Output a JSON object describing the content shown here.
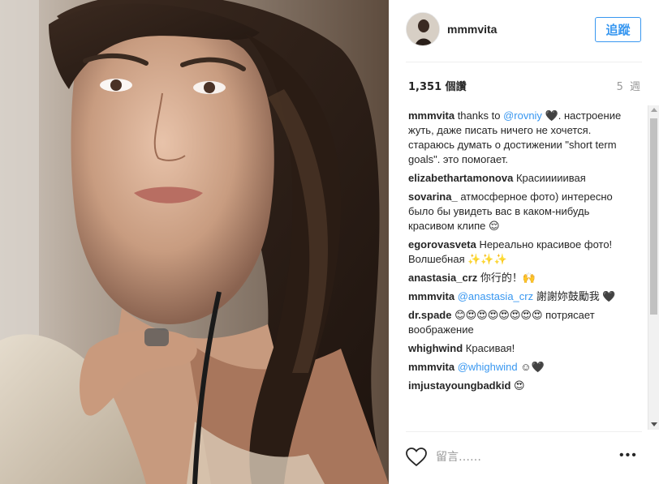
{
  "post": {
    "username": "mmmvita",
    "follow_label": "追蹤",
    "views": "1,351 個讚",
    "age": "5 週"
  },
  "comments": [
    {
      "author": "mmmvita",
      "parts": [
        {
          "t": "text",
          "v": " thanks to "
        },
        {
          "t": "mention",
          "v": "@rovniy"
        },
        {
          "t": "text",
          "v": " 🖤. настроение жуть, даже писать ничего не хочется. стараюсь думать о достижении \"short term goals\". это помогает."
        }
      ]
    },
    {
      "author": "elizabethartamonova",
      "parts": [
        {
          "t": "text",
          "v": " Красииииивая"
        }
      ]
    },
    {
      "author": "sovarina_",
      "parts": [
        {
          "t": "text",
          "v": " атмосферное фото) интересно было бы увидеть вас в каком-нибудь красивом клипе 😌"
        }
      ]
    },
    {
      "author": "egorovasveta",
      "parts": [
        {
          "t": "text",
          "v": " Нереально красивое фото! Волшебная ✨✨✨"
        }
      ]
    },
    {
      "author": "anastasia_crz",
      "parts": [
        {
          "t": "text",
          "v": " 你行的！🙌"
        }
      ]
    },
    {
      "author": "mmmvita",
      "parts": [
        {
          "t": "text",
          "v": " "
        },
        {
          "t": "mention",
          "v": "@anastasia_crz"
        },
        {
          "t": "text",
          "v": " 謝謝妳鼓勵我 🖤"
        }
      ]
    },
    {
      "author": "dr.spade",
      "parts": [
        {
          "t": "text",
          "v": " 😊😍😍😍😍😍😍😍 потрясает воображение"
        }
      ]
    },
    {
      "author": "whighwind",
      "parts": [
        {
          "t": "text",
          "v": " Красивая!"
        }
      ]
    },
    {
      "author": "mmmvita",
      "parts": [
        {
          "t": "text",
          "v": " "
        },
        {
          "t": "mention",
          "v": "@whighwind"
        },
        {
          "t": "text",
          "v": " ☺🖤"
        }
      ]
    },
    {
      "author": "imjustayoungbadkid",
      "parts": [
        {
          "t": "text",
          "v": " 😍"
        }
      ]
    }
  ],
  "actions": {
    "comment_placeholder": "留言……",
    "more_label": "•••"
  },
  "colors": {
    "accent": "#3897f0",
    "text": "#262626",
    "muted": "#999999"
  }
}
